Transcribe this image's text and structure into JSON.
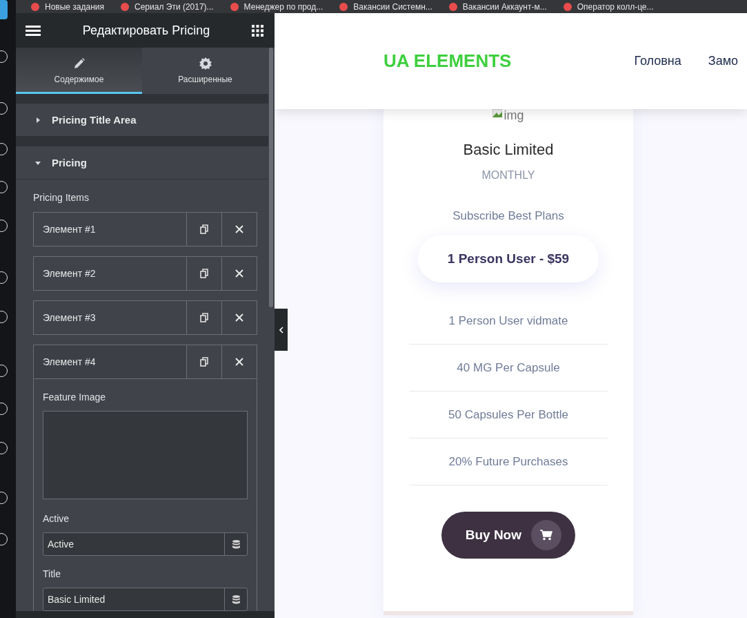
{
  "bookmarks": [
    {
      "label": "Новые задания"
    },
    {
      "label": "Сериал Эти (2017)..."
    },
    {
      "label": "Менеджер по прод..."
    },
    {
      "label": "Вакансии Системн..."
    },
    {
      "label": "Вакансии Аккаунт-м..."
    },
    {
      "label": "Оператор колл-це..."
    }
  ],
  "editor": {
    "title": "Редактировать Pricing",
    "tabs": [
      {
        "label": "Содержимое",
        "selected": true
      },
      {
        "label": "Расширенные",
        "selected": false
      }
    ],
    "sections": [
      {
        "label": "Pricing Title Area",
        "expanded": false
      },
      {
        "label": "Pricing",
        "expanded": true
      }
    ],
    "repeater_label": "Pricing Items",
    "items": [
      {
        "label": "Элемент #1",
        "expanded": false
      },
      {
        "label": "Элемент #2",
        "expanded": false
      },
      {
        "label": "Элемент #3",
        "expanded": false
      },
      {
        "label": "Элемент #4",
        "expanded": true
      }
    ],
    "fields": [
      {
        "label": "Feature Image",
        "kind": "image"
      },
      {
        "label": "Active",
        "kind": "text",
        "value": "Active"
      },
      {
        "label": "Title",
        "kind": "text",
        "value": "Basic Limited"
      }
    ]
  },
  "preview": {
    "logo": "UA ELEMENTS",
    "nav": [
      "Головна",
      "Замо"
    ],
    "card": {
      "image_alt": "img",
      "title": "Basic Limited",
      "period": "MONTHLY",
      "subtitle": "Subscribe Best Plans",
      "price": "1 Person User - $59",
      "features": [
        "1 Person User vidmate",
        "40 MG Per Capsule",
        "50 Capsules Per Bottle",
        "20% Future Purchases"
      ],
      "button": "Buy Now"
    }
  }
}
